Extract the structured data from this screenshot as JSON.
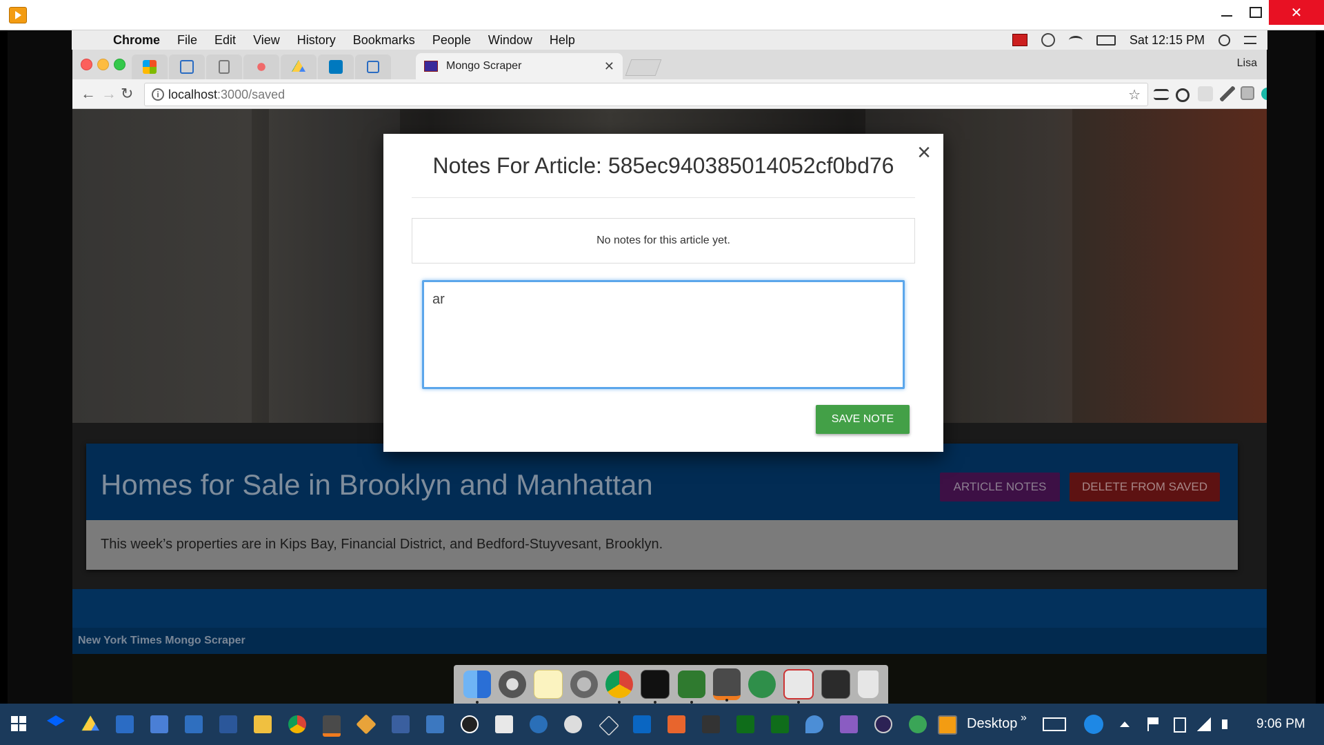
{
  "mac_menubar": {
    "app": "Chrome",
    "menus": [
      "File",
      "Edit",
      "View",
      "History",
      "Bookmarks",
      "People",
      "Window",
      "Help"
    ],
    "clock": "Sat 12:15 PM"
  },
  "browser": {
    "active_tab_title": "Mongo Scraper",
    "profile": "Lisa",
    "url_host": "localhost",
    "url_rest": ":3000/saved"
  },
  "modal": {
    "title": "Notes For Article: 585ec940385014052cf0bd76",
    "close_glyph": "×",
    "empty_text": "No notes for this article yet.",
    "note_value": "ar",
    "save_label": "SAVE NOTE"
  },
  "article": {
    "title": "Homes for Sale in Brooklyn and Manhattan",
    "notes_label": "ARTICLE NOTES",
    "delete_label": "DELETE FROM SAVED",
    "summary": "This week’s properties are in Kips Bay, Financial District, and Bedford-Stuyvesant, Brooklyn."
  },
  "footer": {
    "text": "New York Times Mongo Scraper"
  },
  "taskbar": {
    "desktop_label": "Desktop",
    "chevron": "»",
    "clock": "9:06 PM"
  },
  "colors": {
    "modal_focus_border": "#5ba6eb",
    "save_button": "#43a047",
    "article_header": "#022c54",
    "notes_button": "#3d1045",
    "delete_button": "#5d1212",
    "taskbar": "#1b3a5b"
  }
}
